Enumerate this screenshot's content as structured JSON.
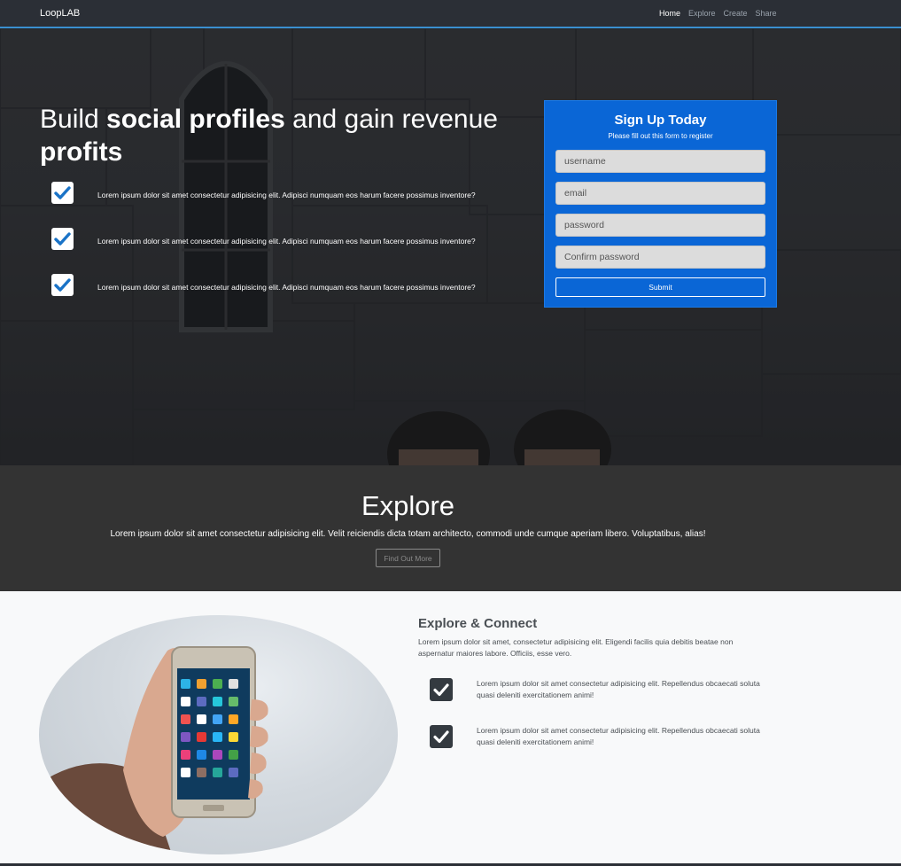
{
  "nav": {
    "brand": "LoopLAB",
    "links": [
      "Home",
      "Explore",
      "Create",
      "Share"
    ]
  },
  "hero": {
    "title_part1": "Build ",
    "title_bold1": "social profiles",
    "title_part2": " and gain revenue ",
    "title_bold2": "profits",
    "features": [
      "Lorem ipsum dolor sit amet consectetur adipisicing elit. Adipisci numquam eos harum facere possimus inventore?",
      "Lorem ipsum dolor sit amet consectetur adipisicing elit. Adipisci numquam eos harum facere possimus inventore?",
      "Lorem ipsum dolor sit amet consectetur adipisicing elit. Adipisci numquam eos harum facere possimus inventore?"
    ]
  },
  "signup": {
    "title": "Sign Up Today",
    "subtitle": "Please fill out this form to register",
    "username_placeholder": "username",
    "email_placeholder": "email",
    "password_placeholder": "password",
    "confirm_placeholder": "Confirm password",
    "submit_label": "Submit"
  },
  "explore": {
    "title": "Explore",
    "text": "Lorem ipsum dolor sit amet consectetur adipisicing elit. Velit reiciendis dicta totam architecto, commodi unde cumque aperiam libero. Voluptatibus, alias!",
    "button_label": "Find Out More"
  },
  "connect": {
    "title": "Explore & Connect",
    "text": "Lorem ipsum dolor sit amet, consectetur adipisicing elit. Eligendi facilis quia debitis beatae non aspernatur maiores labore. Officiis, esse vero.",
    "features": [
      "Lorem ipsum dolor sit amet consectetur adipisicing elit. Repellendus obcaecati soluta quasi deleniti exercitationem animi!",
      "Lorem ipsum dolor sit amet consectetur adipisicing elit. Repellendus obcaecati soluta quasi deleniti exercitationem animi!"
    ]
  },
  "colors": {
    "nav_bg": "#2b2f36",
    "nav_accent": "#3a8fd0",
    "signup_bg": "#0a66d6",
    "check_blue": "#1a73c7",
    "explore_bg": "#333333",
    "connect_check_bg": "#343a40"
  },
  "icons": {
    "hero_check": "check-icon",
    "connect_check": "check-icon"
  }
}
